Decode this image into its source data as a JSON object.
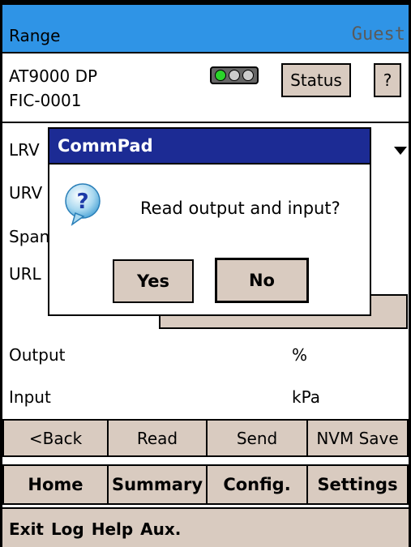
{
  "header": {
    "app_title": "Range",
    "user": "Guest"
  },
  "device": {
    "model": "AT9000 DP",
    "tag": "FIC-0001",
    "status_label": "Status",
    "help_label": "?"
  },
  "fields": {
    "lrv": "LRV",
    "urv": "URV",
    "span": "Span",
    "url": "URL",
    "output_label": "Output",
    "output_unit": "%",
    "input_label": "Input",
    "input_unit": "kPa"
  },
  "actions": [
    "<Back",
    "Read",
    "Send",
    "NVM Save"
  ],
  "nav": [
    "Home",
    "Summary",
    "Config.",
    "Settings"
  ],
  "footer": {
    "menu": "Exit Log Help Aux."
  },
  "dialog": {
    "title": "CommPad",
    "message": "Read output and input?",
    "yes_label": "Yes",
    "no_label": "No",
    "icon": "question-icon"
  }
}
